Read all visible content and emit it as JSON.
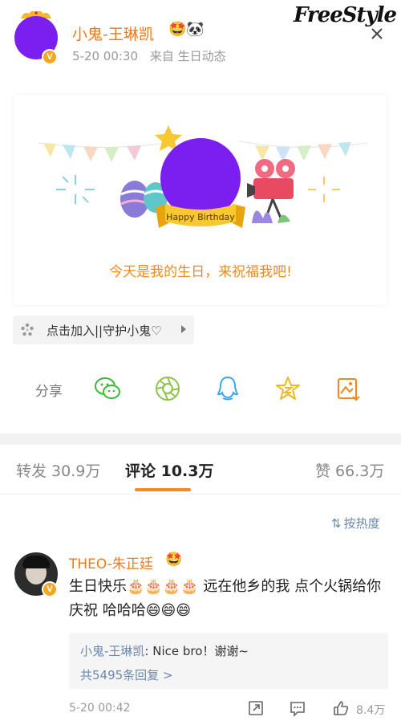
{
  "post": {
    "username": "小鬼-王琳凯",
    "badges": "🤩🐼",
    "date": "5-20 00:30",
    "source": "来自 生日动态",
    "logo": "FreeStyle"
  },
  "card": {
    "banner_text": "Happy Birthday",
    "caption": "今天是我的生日，来祝福我吧!"
  },
  "join": {
    "label": "点击加入||守护小鬼♡"
  },
  "share": {
    "label": "分享",
    "icons": [
      "wechat-icon",
      "moments-icon",
      "qq-icon",
      "qzone-icon",
      "save-image-icon"
    ]
  },
  "tabs": [
    {
      "label": "转发 30.9万"
    },
    {
      "label": "评论 10.3万"
    },
    {
      "label": "赞 66.3万"
    }
  ],
  "sort": {
    "label": "按热度"
  },
  "comment": {
    "name": "THEO-朱正廷",
    "badge": "🤩",
    "text": "生日快乐🎂🎂🎂🎂 远在他乡的我 点个火锅给你庆祝 哈哈哈😄😄😄",
    "reply_author": "小鬼-王琳凯",
    "reply_text": ": Nice bro！谢谢~",
    "reply_more": "共5495条回复 >",
    "time": "5-20 00:42",
    "like_count": "8.4万"
  },
  "colors": {
    "accent_orange": "#f58a1f",
    "link_blue": "#6b87ad",
    "avatar_purple": "#7a1ff0"
  }
}
